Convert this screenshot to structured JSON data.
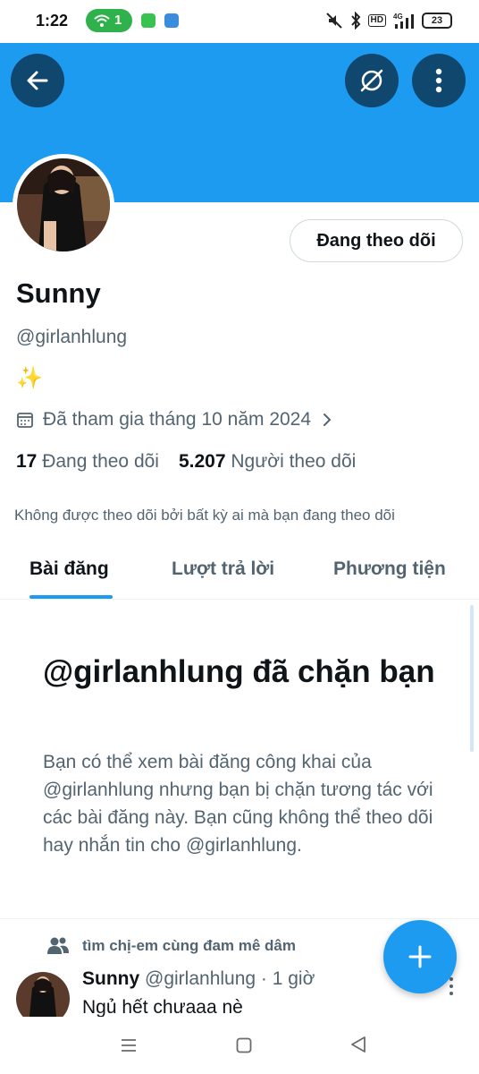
{
  "status_bar": {
    "time": "1:22",
    "wifi_badge": "1",
    "network": "4G",
    "hd": "HD",
    "battery": "23"
  },
  "header": {
    "back_icon": "arrow-left-icon",
    "grok_icon": "grok-icon",
    "more_icon": "more-vertical-icon",
    "banner_color": "#1d9bf0"
  },
  "profile": {
    "follow_button": "Đang theo dõi",
    "name": "Sunny",
    "handle": "@girlanhlung",
    "bio": "✨",
    "joined": "Đã tham gia tháng 10 năm 2024",
    "following_count": "17",
    "following_label": "Đang theo dõi",
    "followers_count": "5.207",
    "followers_label": "Người theo dõi",
    "not_followed_text": "Không được theo dõi bởi bất kỳ ai mà bạn đang theo dõi"
  },
  "tabs": [
    {
      "label": "Bài đăng",
      "active": true
    },
    {
      "label": "Lượt trả lời",
      "active": false
    },
    {
      "label": "Phương tiện",
      "active": false
    }
  ],
  "blocked": {
    "title": "@girlanhlung đã chặn bạn",
    "text": "Bạn có thể xem bài đăng công khai của @girlanhlung nhưng bạn bị chặn tương tác với các bài đăng này. Bạn cũng không thể theo dõi hay nhắn tin cho @girlanhlung."
  },
  "tweet": {
    "context": "tìm chị-em cùng đam mê dâm",
    "name": "Sunny",
    "meta": "@girlanhlung · 1 giờ",
    "text": "Ngủ hết chưaaa nè"
  },
  "accent_color": "#1d9bf0"
}
